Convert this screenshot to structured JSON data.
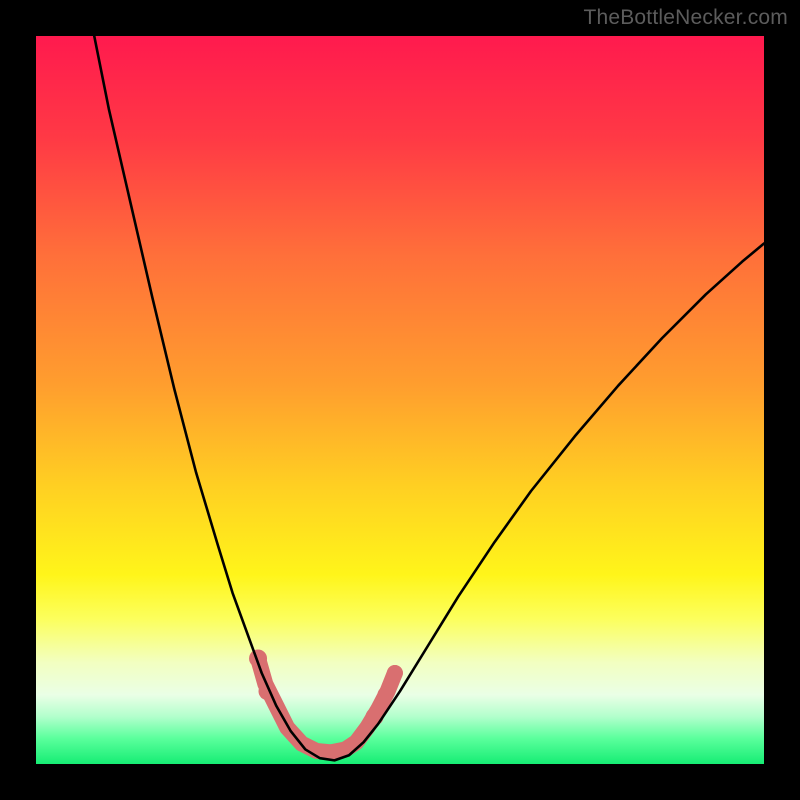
{
  "watermark": {
    "text": "TheBottleNecker.com"
  },
  "chart_data": {
    "type": "line",
    "title": "",
    "xlabel": "",
    "ylabel": "",
    "xlim": [
      0,
      100
    ],
    "ylim": [
      0,
      100
    ],
    "background_gradient_stops": [
      {
        "offset": 0.0,
        "color": "#ff1a4e"
      },
      {
        "offset": 0.14,
        "color": "#ff3945"
      },
      {
        "offset": 0.3,
        "color": "#ff6f3a"
      },
      {
        "offset": 0.48,
        "color": "#ff9e2e"
      },
      {
        "offset": 0.62,
        "color": "#ffd022"
      },
      {
        "offset": 0.74,
        "color": "#fff51a"
      },
      {
        "offset": 0.8,
        "color": "#fcff5c"
      },
      {
        "offset": 0.86,
        "color": "#f2ffc0"
      },
      {
        "offset": 0.905,
        "color": "#eaffe6"
      },
      {
        "offset": 0.935,
        "color": "#b2ffcc"
      },
      {
        "offset": 0.965,
        "color": "#5aff9c"
      },
      {
        "offset": 1.0,
        "color": "#16ed74"
      }
    ],
    "series": [
      {
        "name": "bottleneck-curve",
        "stroke": "#000000",
        "stroke_width": 2.6,
        "points": [
          {
            "x": 8.0,
            "y": 100.0
          },
          {
            "x": 10.0,
            "y": 90.0
          },
          {
            "x": 13.0,
            "y": 77.0
          },
          {
            "x": 16.0,
            "y": 64.0
          },
          {
            "x": 19.0,
            "y": 51.5
          },
          {
            "x": 22.0,
            "y": 40.0
          },
          {
            "x": 25.0,
            "y": 30.0
          },
          {
            "x": 27.0,
            "y": 23.5
          },
          {
            "x": 29.0,
            "y": 18.0
          },
          {
            "x": 31.0,
            "y": 12.5
          },
          {
            "x": 33.0,
            "y": 8.0
          },
          {
            "x": 35.0,
            "y": 4.5
          },
          {
            "x": 37.0,
            "y": 2.0
          },
          {
            "x": 39.0,
            "y": 0.8
          },
          {
            "x": 41.0,
            "y": 0.5
          },
          {
            "x": 43.0,
            "y": 1.2
          },
          {
            "x": 45.0,
            "y": 3.0
          },
          {
            "x": 47.0,
            "y": 5.5
          },
          {
            "x": 50.0,
            "y": 10.0
          },
          {
            "x": 54.0,
            "y": 16.5
          },
          {
            "x": 58.0,
            "y": 23.0
          },
          {
            "x": 63.0,
            "y": 30.5
          },
          {
            "x": 68.0,
            "y": 37.5
          },
          {
            "x": 74.0,
            "y": 45.0
          },
          {
            "x": 80.0,
            "y": 52.0
          },
          {
            "x": 86.0,
            "y": 58.5
          },
          {
            "x": 92.0,
            "y": 64.5
          },
          {
            "x": 97.0,
            "y": 69.0
          },
          {
            "x": 100.0,
            "y": 71.5
          }
        ]
      },
      {
        "name": "trough-band",
        "stroke": "#d96f70",
        "stroke_width": 16,
        "points": [
          {
            "x": 30.5,
            "y": 14.5
          },
          {
            "x": 31.5,
            "y": 11.0
          },
          {
            "x": 33.0,
            "y": 8.0
          },
          {
            "x": 34.5,
            "y": 5.0
          },
          {
            "x": 36.5,
            "y": 2.8
          },
          {
            "x": 38.5,
            "y": 1.8
          },
          {
            "x": 40.5,
            "y": 1.6
          },
          {
            "x": 42.5,
            "y": 2.0
          },
          {
            "x": 44.0,
            "y": 3.0
          },
          {
            "x": 45.5,
            "y": 5.0
          },
          {
            "x": 47.0,
            "y": 7.5
          },
          {
            "x": 48.3,
            "y": 10.0
          },
          {
            "x": 49.3,
            "y": 12.5
          }
        ]
      }
    ],
    "markers": [
      {
        "x": 30.5,
        "y": 14.5,
        "r": 9,
        "fill": "#d96f70"
      },
      {
        "x": 31.8,
        "y": 10.0,
        "r": 9,
        "fill": "#d96f70"
      },
      {
        "x": 46.5,
        "y": 6.5,
        "r": 9,
        "fill": "#d96f70"
      },
      {
        "x": 48.0,
        "y": 9.5,
        "r": 8,
        "fill": "#d96f70"
      },
      {
        "x": 49.3,
        "y": 12.5,
        "r": 8,
        "fill": "#d96f70"
      }
    ]
  }
}
